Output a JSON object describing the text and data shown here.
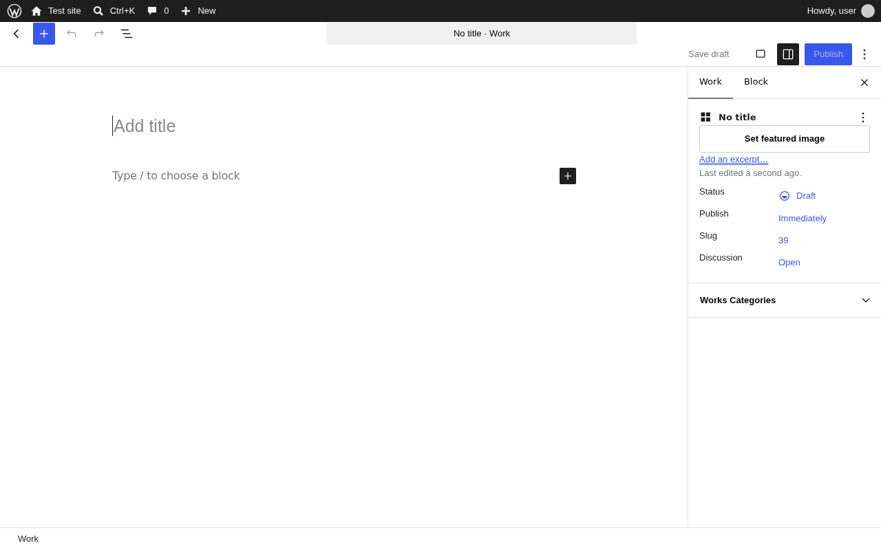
{
  "admin_bar": {
    "items": [
      {
        "kind": "logo"
      },
      {
        "kind": "home",
        "label": "Test site"
      },
      {
        "kind": "search",
        "label": "Ctrl+K"
      },
      {
        "kind": "comments",
        "label": "0"
      },
      {
        "kind": "new",
        "label": "New"
      }
    ],
    "greeting": "Howdy, user"
  },
  "toolbar": {
    "document_title": "No title · Work",
    "undo_disabled": true,
    "redo_disabled": true,
    "save_draft": "Save draft",
    "publish": "Publish",
    "settings_open": true
  },
  "editor": {
    "title_placeholder": "Add title",
    "block_placeholder": "Type / to choose a block"
  },
  "sidebar": {
    "tabs": [
      {
        "label": "Work",
        "selected": true
      },
      {
        "label": "Block",
        "selected": false
      }
    ],
    "post_title": "No title",
    "featured_button": "Set featured image",
    "excerpt_link": "Add an excerpt…",
    "last_edited": "Last edited a second ago.",
    "fields": [
      {
        "label": "Status",
        "value": "Draft",
        "kind": "status"
      },
      {
        "label": "Publish",
        "value": "Immediately",
        "kind": "link"
      },
      {
        "label": "Slug",
        "value": "39",
        "kind": "link"
      },
      {
        "label": "Discussion",
        "value": "Open",
        "kind": "link"
      }
    ],
    "panels": [
      {
        "title": "Works Categories",
        "expanded": false
      }
    ]
  },
  "breadcrumb": "Work"
}
